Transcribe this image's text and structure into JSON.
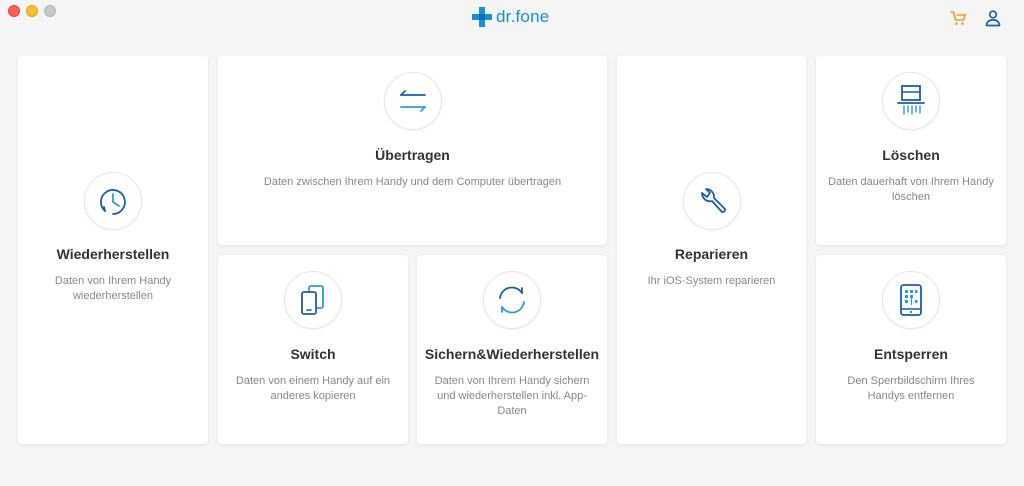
{
  "app": {
    "logo_text": "dr.fone",
    "colors": {
      "accent": "#1591d7",
      "cart": "#f59a1b",
      "icon_blue": "#1b5fa8",
      "icon_light": "#2f9be0"
    }
  },
  "header": {
    "icons": [
      "cart-icon",
      "user-icon"
    ]
  },
  "cards": {
    "restore": {
      "title": "Wiederherstellen",
      "desc": "Daten von Ihrem Handy wiederherstellen",
      "icon": "clock-icon"
    },
    "transfer": {
      "title": "Übertragen",
      "desc": "Daten zwischen Ihrem Handy und dem Computer übertragen",
      "icon": "transfer-arrows-icon"
    },
    "switch": {
      "title": "Switch",
      "desc": "Daten von einem Handy auf ein anderes kopieren",
      "icon": "phone-switch-icon"
    },
    "backup": {
      "title": "Sichern&Wiederherstellen",
      "desc": "Daten von Ihrem Handy sichern und wiederherstellen inkl. App-Daten",
      "icon": "sync-icon"
    },
    "repair": {
      "title": "Reparieren",
      "desc": "Ihr iOS-System reparieren",
      "icon": "wrench-icon"
    },
    "erase": {
      "title": "Löschen",
      "desc": "Daten dauerhaft von Ihrem Handy löschen",
      "icon": "shredder-icon"
    },
    "unlock": {
      "title": "Entsperren",
      "desc": "Den Sperrbildschirm Ihres Handys entfernen",
      "icon": "phone-unlock-icon"
    }
  }
}
